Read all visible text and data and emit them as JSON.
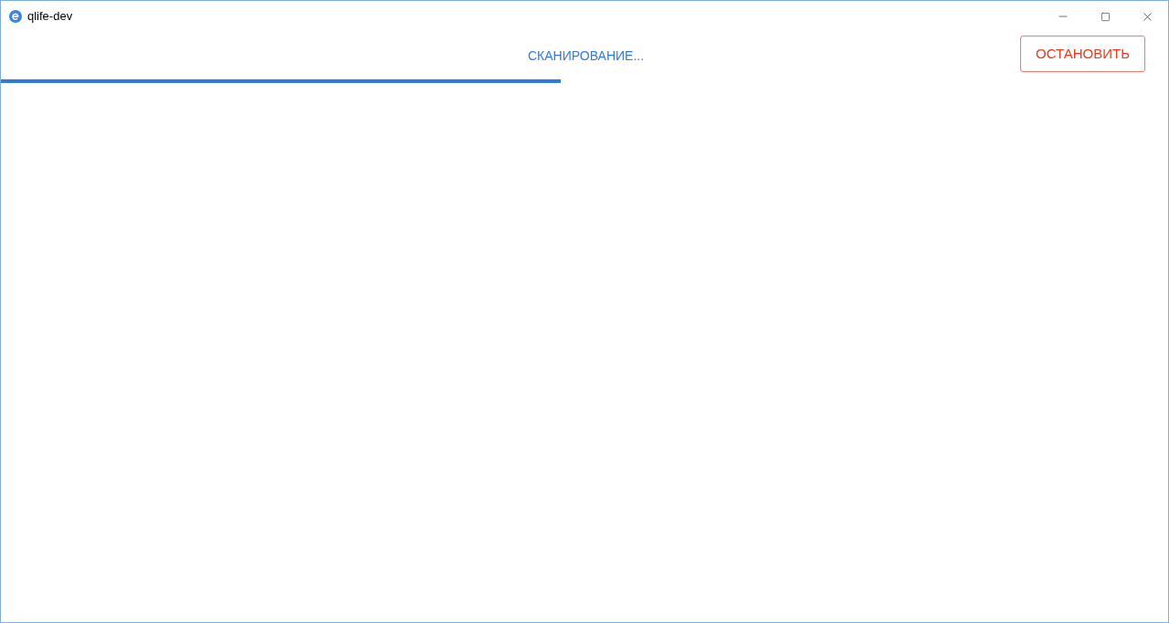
{
  "window": {
    "title": "qlife-dev"
  },
  "scan": {
    "status": "СКАНИРОВАНИЕ...",
    "level": 0.48
  },
  "stop_button": {
    "label": "ОСТАНОВИТЬ"
  }
}
